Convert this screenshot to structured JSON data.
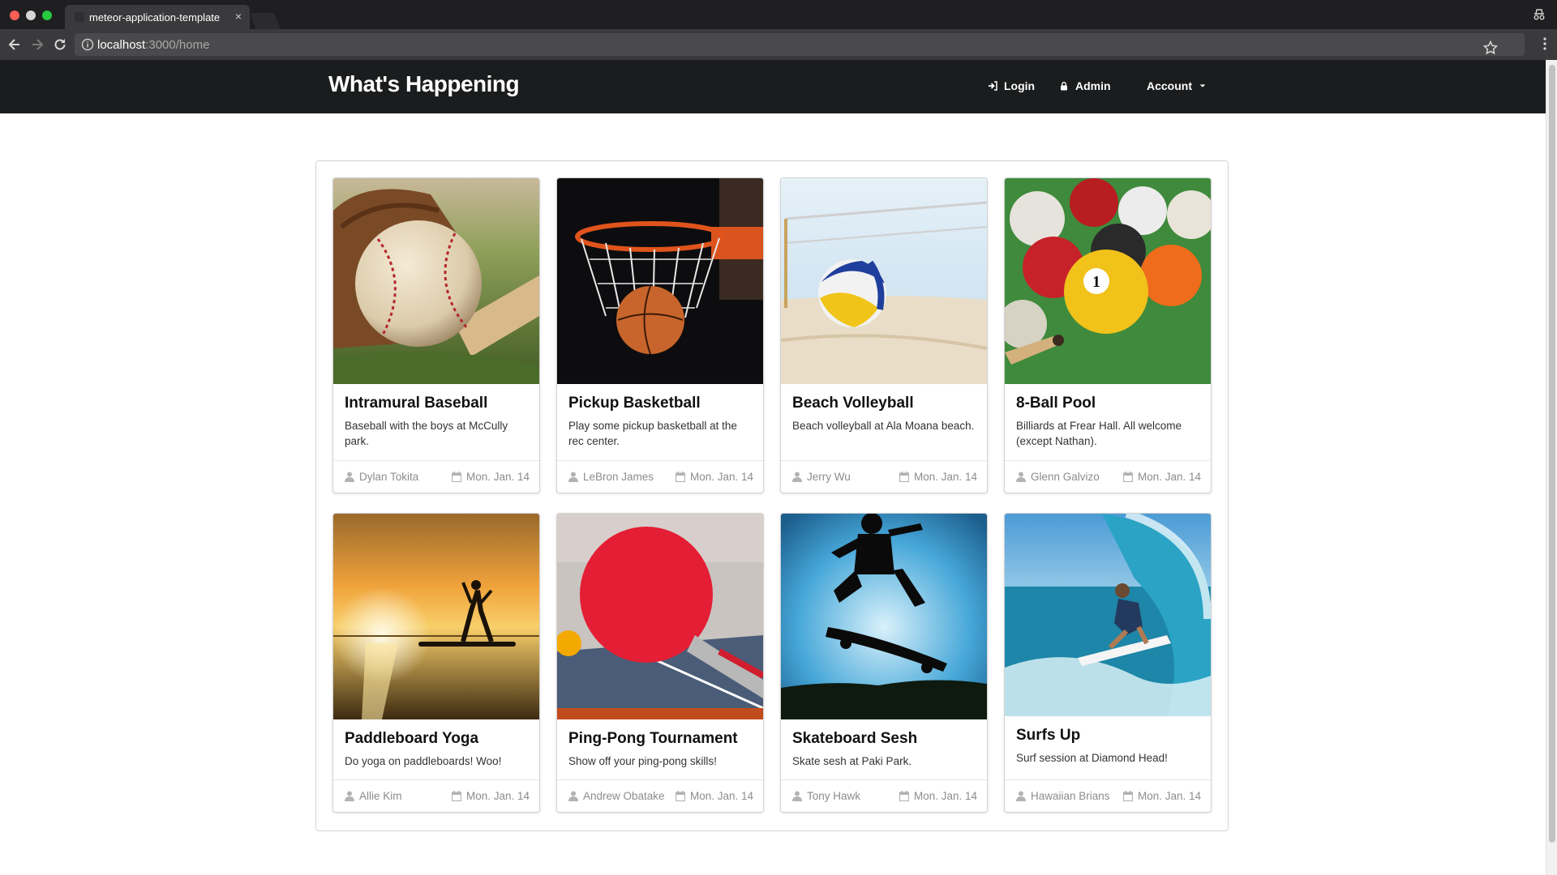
{
  "browser": {
    "tab_title": "meteor-application-template",
    "url_host": "localhost",
    "url_path": ":3000/home"
  },
  "navbar": {
    "brand": "What's Happening",
    "login": "Login",
    "admin": "Admin",
    "account": "Account"
  },
  "cards": [
    {
      "title": "Intramural Baseball",
      "description": "Baseball with the boys at McCully park.",
      "user": "Dylan Tokita",
      "date": "Mon. Jan. 14"
    },
    {
      "title": "Pickup Basketball",
      "description": "Play some pickup basketball at the rec center.",
      "user": "LeBron James",
      "date": "Mon. Jan. 14"
    },
    {
      "title": "Beach Volleyball",
      "description": "Beach volleyball at Ala Moana beach.",
      "user": "Jerry Wu",
      "date": "Mon. Jan. 14"
    },
    {
      "title": "8-Ball Pool",
      "description": "Billiards at Frear Hall. All welcome (except Nathan).",
      "user": "Glenn Galvizo",
      "date": "Mon. Jan. 14"
    },
    {
      "title": "Paddleboard Yoga",
      "description": "Do yoga on paddleboards! Woo!",
      "user": "Allie Kim",
      "date": "Mon. Jan. 14"
    },
    {
      "title": "Ping-Pong Tournament",
      "description": "Show off your ping-pong skills!",
      "user": "Andrew Obatake",
      "date": "Mon. Jan. 14"
    },
    {
      "title": "Skateboard Sesh",
      "description": "Skate sesh at Paki Park.",
      "user": "Tony Hawk",
      "date": "Mon. Jan. 14"
    },
    {
      "title": "Surfs Up",
      "description": "Surf session at Diamond Head!",
      "user": "Hawaiian Brians",
      "date": "Mon. Jan. 14"
    }
  ]
}
